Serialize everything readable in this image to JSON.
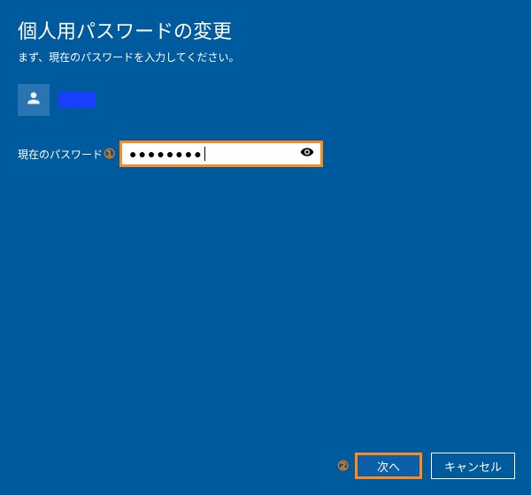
{
  "header": {
    "title": "個人用パスワードの変更",
    "subtitle": "まず、現在のパスワードを入力してください。"
  },
  "user": {
    "avatar_icon": "person-icon",
    "name_redacted": true
  },
  "form": {
    "current_password_label": "現在のパスワード",
    "current_password_mask": "●●●●●●●●",
    "reveal_icon": "eye-icon"
  },
  "annotations": {
    "step1": "①",
    "step2": "②"
  },
  "footer": {
    "next_label": "次へ",
    "cancel_label": "キャンセル"
  },
  "colors": {
    "bg": "#005a9e",
    "highlight": "#ff8c1a",
    "redaction": "#1a3fff"
  }
}
